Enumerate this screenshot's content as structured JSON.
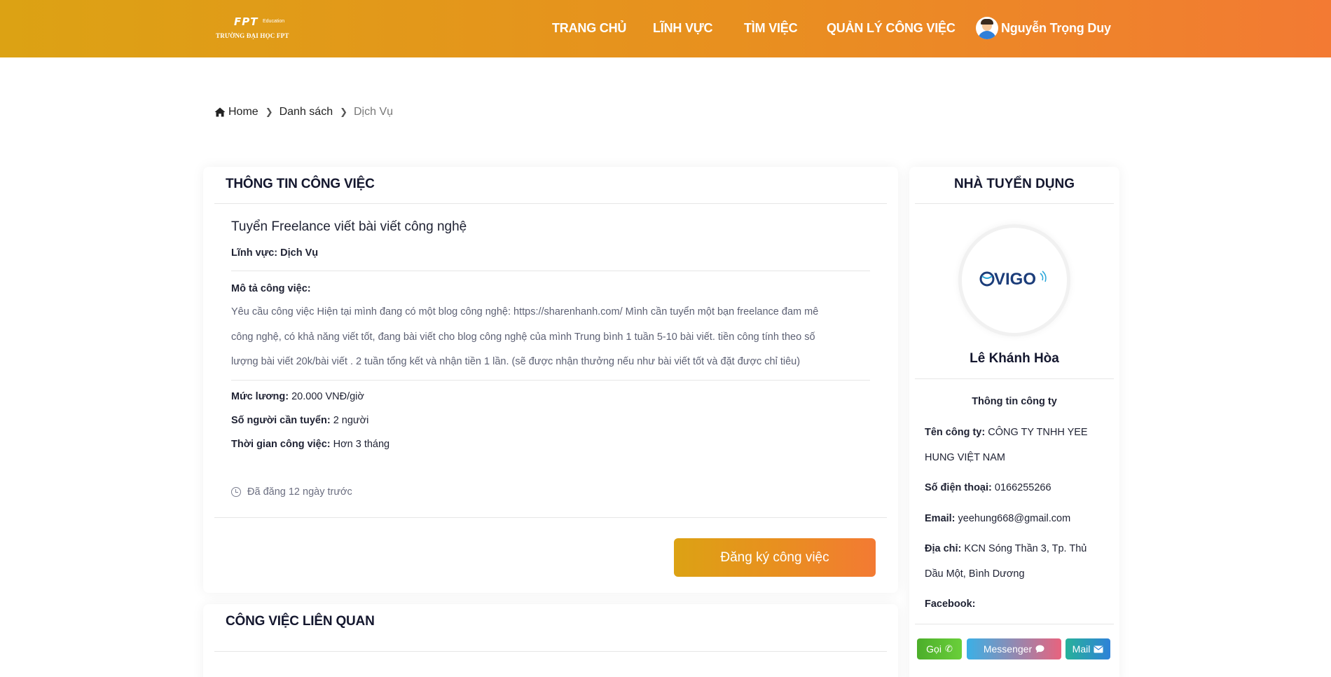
{
  "header": {
    "logo_brand": "FPT",
    "logo_sub": "Education",
    "logo_school": "TRƯỜNG ĐẠI HỌC FPT",
    "nav": [
      "TRANG CHỦ",
      "LĨNH VỰC",
      "TÌM VIỆC",
      "QUẢN LÝ CÔNG VIỆC"
    ],
    "user_name": "Nguyễn Trọng Duy"
  },
  "breadcrumb": {
    "home": "Home",
    "list": "Danh sách",
    "current": "Dịch Vụ"
  },
  "job": {
    "section_title": "THÔNG TIN CÔNG VIỆC",
    "title": "Tuyển Freelance viết bài viết công nghệ",
    "field_label": "Lĩnh vực:",
    "field_value": "Dịch Vụ",
    "desc_label": "Mô tả công việc:",
    "desc_lines": [
      "Yêu cầu công việc Hiện tại mình đang có một blog công nghệ: https://sharenhanh.com/ Mình cần tuyển một bạn freelance đam mê",
      "công nghệ, có khả năng viết tốt, đang bài viết cho blog công nghệ của mình Trung bình 1 tuần 5-10 bài viết. tiền công tính theo số",
      "lượng bài viết 20k/bài viết . 2 tuần tổng kết và nhận tiền 1 lần. (sẽ được nhận thưởng nếu như bài viết tốt và đặt được chỉ tiêu)"
    ],
    "salary_label": "Mức lương:",
    "salary_value": "20.000 VNĐ/giờ",
    "count_label": "Số người cần tuyển:",
    "count_value": "2 người",
    "duration_label": "Thời gian công việc:",
    "duration_value": "Hơn 3 tháng",
    "posted": "Đã đăng 12 ngày trước",
    "apply_label": "Đăng ký công việc"
  },
  "related": {
    "section_title": "CÔNG VIỆC LIÊN QUAN"
  },
  "recruiter": {
    "section_title": "NHÀ TUYỂN DỤNG",
    "logo_text": "VIGO",
    "name": "Lê Khánh Hòa",
    "info_heading": "Thông tin công ty",
    "company_label": "Tên công ty:",
    "company_value": "CÔNG TY TNHH YEE HUNG VIỆT NAM",
    "phone_label": "Số điện thoại:",
    "phone_value": "0166255266",
    "email_label": "Email:",
    "email_value": "yeehung668@gmail.com",
    "address_label": "Địa chỉ:",
    "address_value": "KCN Sóng Thần 3, Tp. Thủ Dầu Một, Bình Dương",
    "facebook_label": "Facebook:",
    "call_label": "Gọi",
    "messenger_label": "Messenger",
    "mail_label": "Mail"
  },
  "colors": {
    "header_gradient_start": "#dca214",
    "header_gradient_end": "#f37a33",
    "call_button": "#4cae2a",
    "messenger_button": "#3ab0e6",
    "mail_button": "#2f82d8"
  },
  "icons": [
    "home-icon",
    "chevron-right-icon",
    "clock-icon",
    "phone-icon",
    "chat-icon",
    "envelope-icon",
    "avatar"
  ]
}
